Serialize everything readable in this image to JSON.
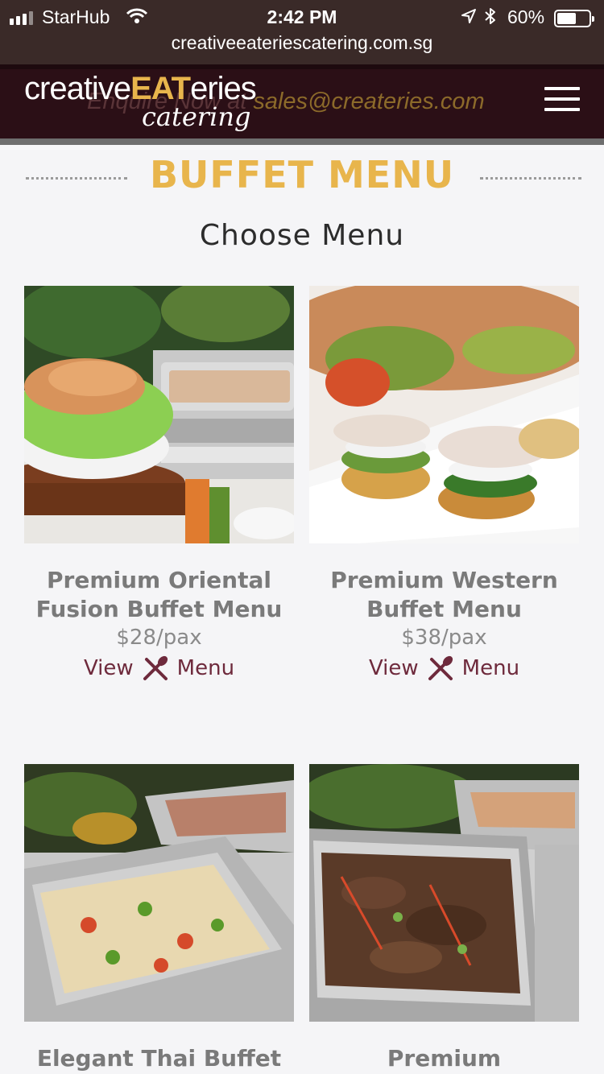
{
  "status_bar": {
    "carrier": "StarHub",
    "time": "2:42 PM",
    "battery": "60%",
    "battery_level": 0.6,
    "url": "creativeeateriescatering.com.sg"
  },
  "header": {
    "logo_prefix": "creative",
    "logo_highlight": "EAT",
    "logo_suffix": "eries",
    "logo_sub": "catering",
    "enquire_text": "Enquire Now at ",
    "email": "sales@createries.com",
    "colors": {
      "header_bg": "#2b0f16",
      "accent": "#e8b54c"
    }
  },
  "page": {
    "section_title": "BUFFET MENU",
    "subtitle": "Choose Menu"
  },
  "menus": [
    {
      "name": "Premium Oriental Fusion Buffet Menu",
      "price": "$28/pax",
      "view_label": "View",
      "menu_label": "Menu"
    },
    {
      "name": "Premium Western Buffet Menu",
      "price": "$38/pax",
      "view_label": "View",
      "menu_label": "Menu"
    },
    {
      "name": "Elegant Thai Buffet",
      "price": "",
      "view_label": "",
      "menu_label": ""
    },
    {
      "name": "Premium",
      "price": "",
      "view_label": "",
      "menu_label": ""
    }
  ]
}
